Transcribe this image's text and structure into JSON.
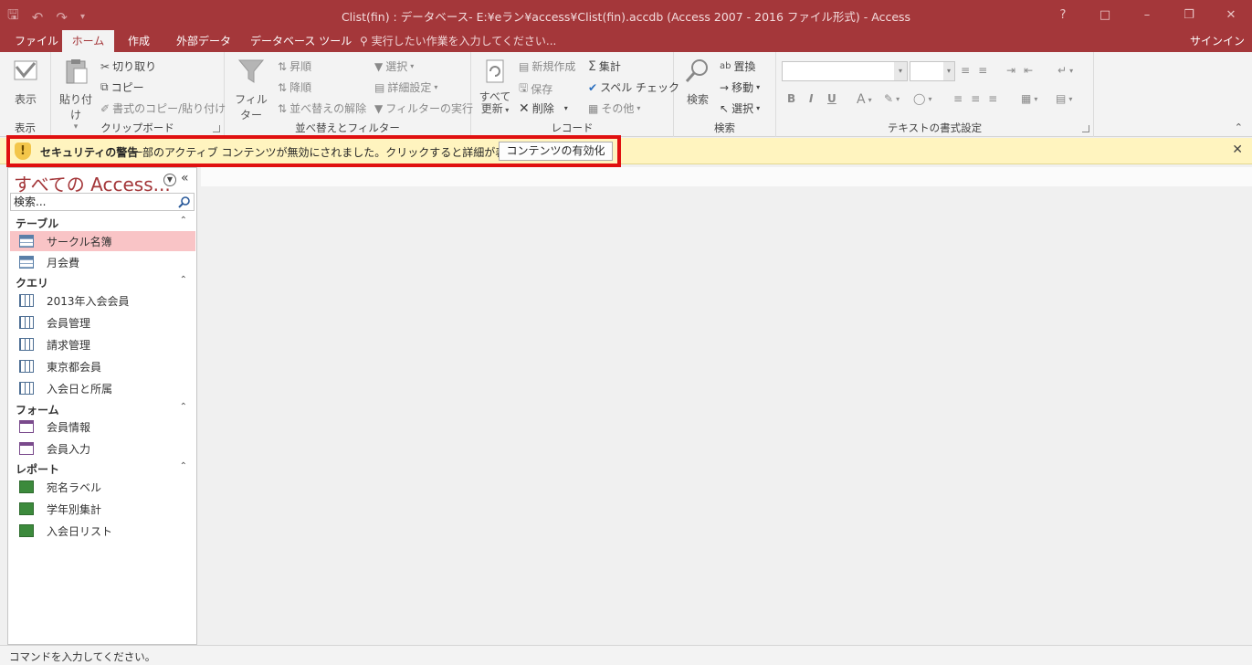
{
  "window": {
    "title": "Clist(fin) : データベース- E:¥eラン¥access¥Clist(fin).accdb (Access 2007 - 2016 ファイル形式) - Access"
  },
  "tabs": [
    {
      "label": "ファイル"
    },
    {
      "label": "ホーム"
    },
    {
      "label": "作成"
    },
    {
      "label": "外部データ"
    },
    {
      "label": "データベース ツール"
    }
  ],
  "tell_me": "実行したい作業を入力してください...",
  "signin": "サインイン",
  "ribbon": {
    "view": {
      "label": "表示",
      "group": "表示"
    },
    "clipboard": {
      "paste": "貼り付け",
      "cut": "切り取り",
      "copy": "コピー",
      "format_painter": "書式のコピー/貼り付け",
      "group": "クリップボード"
    },
    "sort_filter": {
      "filter": "フィルター",
      "ascending": "昇順",
      "descending": "降順",
      "clear_sort": "並べ替えの解除",
      "selection": "選択",
      "advanced": "詳細設定",
      "toggle_filter": "フィルターの実行",
      "group": "並べ替えとフィルター"
    },
    "records": {
      "refresh_line1": "すべて",
      "refresh_line2": "更新",
      "new": "新規作成",
      "save": "保存",
      "delete": "削除",
      "totals": "集計",
      "spelling": "スペル チェック",
      "more": "その他",
      "group": "レコード"
    },
    "find": {
      "find": "検索",
      "replace": "置換",
      "goto": "移動",
      "select": "選択",
      "group": "検索"
    },
    "text_formatting": {
      "bold": "B",
      "italic": "I",
      "underline": "U",
      "font_color": "A",
      "group": "テキストの書式設定"
    }
  },
  "security_bar": {
    "title": "セキュリティの警告",
    "message": "一部のアクティブ コンテンツが無効にされました。クリックすると詳細が表示されます。",
    "enable_button": "コンテンツの有効化"
  },
  "nav": {
    "title": "すべての Access...",
    "search_placeholder": "検索...",
    "sections": [
      {
        "title": "テーブル",
        "items": [
          {
            "label": "サークル名簿",
            "type": "table",
            "selected": true
          },
          {
            "label": "月会費",
            "type": "table"
          }
        ]
      },
      {
        "title": "クエリ",
        "items": [
          {
            "label": "2013年入会会員",
            "type": "query"
          },
          {
            "label": "会員管理",
            "type": "query"
          },
          {
            "label": "請求管理",
            "type": "query"
          },
          {
            "label": "東京都会員",
            "type": "query"
          },
          {
            "label": "入会日と所属",
            "type": "query"
          }
        ]
      },
      {
        "title": "フォーム",
        "items": [
          {
            "label": "会員情報",
            "type": "form"
          },
          {
            "label": "会員入力",
            "type": "form"
          }
        ]
      },
      {
        "title": "レポート",
        "items": [
          {
            "label": "宛名ラベル",
            "type": "report"
          },
          {
            "label": "学年別集計",
            "type": "report"
          },
          {
            "label": "入会日リスト",
            "type": "report"
          }
        ]
      }
    ]
  },
  "status": "コマンドを入力してください。",
  "colors": {
    "accent": "#a4373a",
    "security_bar": "#fff4bf",
    "highlight_border": "#e01010",
    "selected_item": "#f9c4c6"
  }
}
